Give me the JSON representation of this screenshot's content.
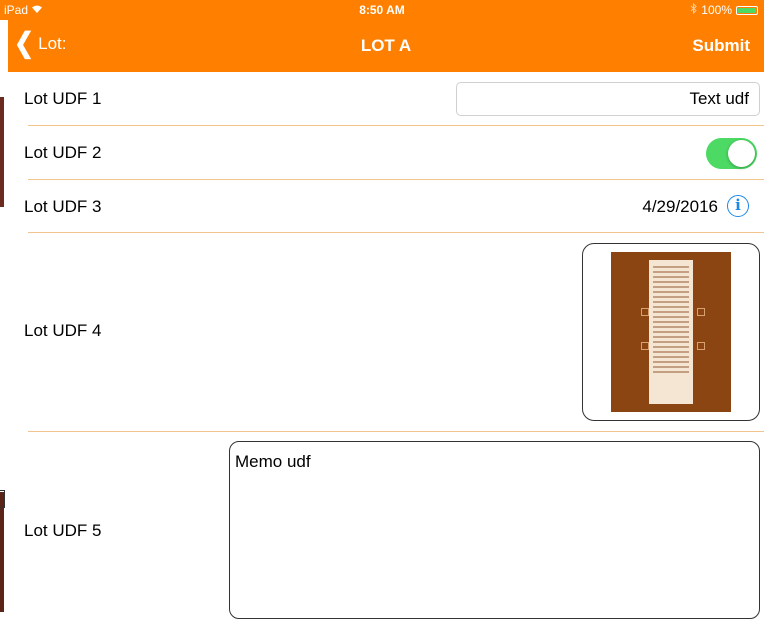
{
  "status_bar": {
    "device": "iPad",
    "wifi_icon": "wifi-icon",
    "time": "8:50 AM",
    "bluetooth_icon": "bluetooth-icon",
    "battery": "100%",
    "battery_level": 1.0
  },
  "nav": {
    "back_label": "Lot:",
    "title": "LOT A",
    "submit_label": "Submit"
  },
  "colors": {
    "accent": "#ff8000",
    "separator": "#f3c48d",
    "toggle_on": "#4cd964",
    "info_blue": "#1e88e5"
  },
  "rows": [
    {
      "label": "Lot UDF 1",
      "type": "text",
      "value": "Text udf"
    },
    {
      "label": "Lot UDF 2",
      "type": "toggle",
      "on": true
    },
    {
      "label": "Lot UDF 3",
      "type": "date",
      "value": "4/29/2016",
      "icon": "info-icon"
    },
    {
      "label": "Lot UDF 4",
      "type": "image"
    },
    {
      "label": "Lot UDF 5",
      "type": "memo",
      "value": "Memo udf"
    }
  ]
}
